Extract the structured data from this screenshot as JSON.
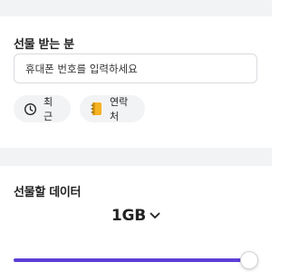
{
  "gift_recipient": {
    "title": "선물 받는 분",
    "phone_placeholder": "휴대폰 번호를 입력하세요",
    "phone_value": "",
    "recent_button": {
      "label": "최근",
      "icon": "clock-icon"
    },
    "contacts_button": {
      "label": "연락처",
      "icon": "address-book-icon"
    }
  },
  "gift_data": {
    "title": "선물할 데이터",
    "amount": "1GB",
    "slider_fraction": 1.0
  },
  "colors": {
    "accent": "#5b3fd6",
    "background_band": "#f2f3f5",
    "contacts_icon": "#f5b323"
  }
}
